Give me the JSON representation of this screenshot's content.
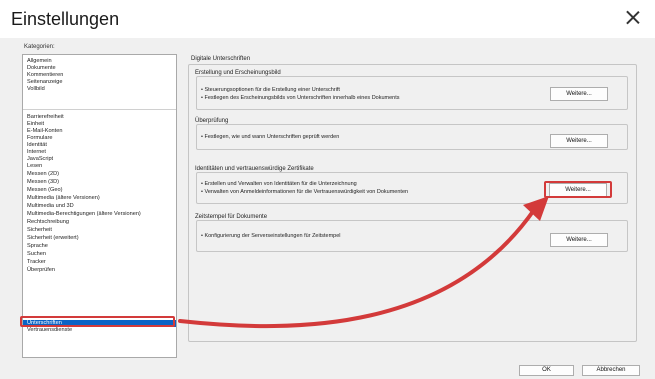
{
  "window": {
    "title": "Einstellungen"
  },
  "categories": {
    "label": "Kategorien:",
    "group1": [
      "Allgemein",
      "Dokumente",
      "Kommentieren",
      "Seitenanzeige",
      "Vollbild"
    ],
    "group2": [
      "Barrierefreiheit",
      "Einheit",
      "E-Mail-Konten",
      "Formulare",
      "Identität",
      "Internet",
      "JavaScript",
      "Lesen",
      "Messen (2D)",
      "Messen (3D)",
      "Messen (Geo)",
      "Multimedia (ältere Versionen)",
      "Multimedia und 3D",
      "Multimedia-Berechtigungen (ältere Versionen)",
      "Rechtschreibung",
      "Sicherheit",
      "Sicherheit (erweitert)",
      "Sprache",
      "Suchen",
      "Tracker",
      "Überprüfen",
      "Unterschriften",
      "Vertrauensdienste"
    ],
    "selected": "Unterschriften"
  },
  "panel": {
    "title": "Digitale Unterschriften",
    "groups": [
      {
        "title": "Erstellung und Erscheinungsbild",
        "bullets": [
          "• Steuerungsoptionen für die Erstellung einer Unterschrift",
          "• Festlegen des Erscheinungsbilds von Unterschriften innerhalb eines Dokuments"
        ],
        "button": "Weitere..."
      },
      {
        "title": "Überprüfung",
        "bullets": [
          "• Festlegen, wie und wann Unterschriften geprüft werden"
        ],
        "button": "Weitere..."
      },
      {
        "title": "Identitäten und vertrauenswürdige Zertifikate",
        "bullets": [
          "• Erstellen und Verwalten von Identitäten für die Unterzeichnung",
          "• Verwalten von Anmeldeinformationen für die Vertrauenswürdigkeit von Dokumenten"
        ],
        "button": "Weitere..."
      },
      {
        "title": "Zeitstempel für Dokumente",
        "bullets": [
          "• Konfigurierung der Serverseinstellungen für Zeitstempel"
        ],
        "button": "Weitere..."
      }
    ]
  },
  "footer": {
    "ok": "OK",
    "cancel": "Abbrechen"
  },
  "annotation": {
    "color": "#d33a3a"
  }
}
